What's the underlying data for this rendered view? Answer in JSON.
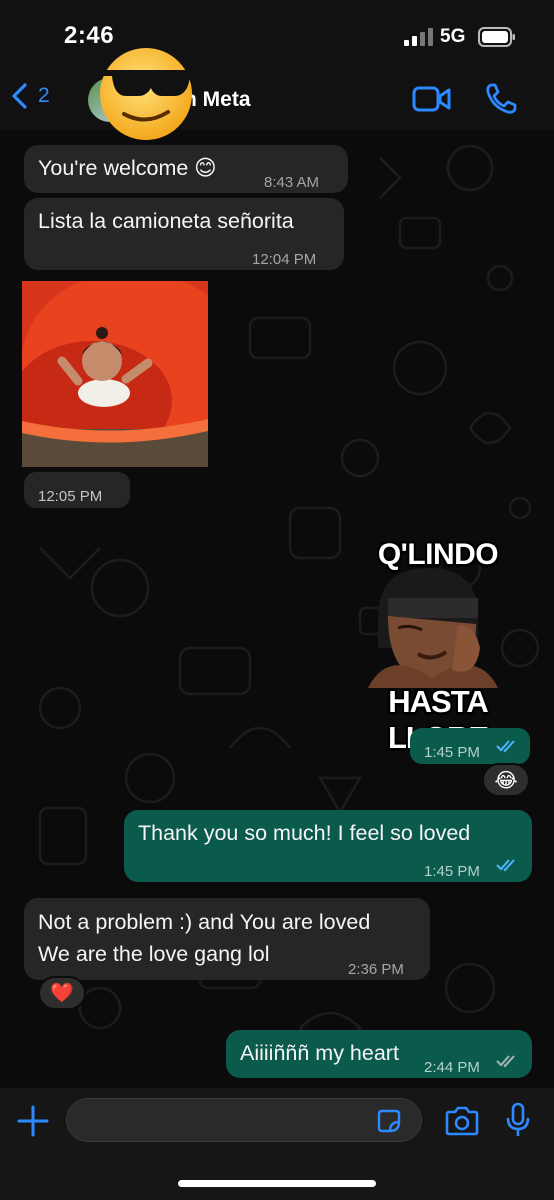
{
  "status_bar": {
    "time": "2:46",
    "network": "5G"
  },
  "header": {
    "back_count": "2",
    "contact_name": "n Meta",
    "icons": [
      "chevron-left-icon",
      "video-icon",
      "phone-icon"
    ]
  },
  "messages": [
    {
      "direction": "in",
      "text": "You're welcome 😊",
      "time": "8:43 AM"
    },
    {
      "direction": "in",
      "text": "Lista la camioneta señorita",
      "time": "12:04 PM"
    },
    {
      "direction": "in",
      "type": "photo",
      "time": "12:05 PM"
    },
    {
      "direction": "out",
      "type": "sticker",
      "sticker_top": "Q'LINDO",
      "sticker_bottom": "HASTA LLORE",
      "time": "1:45 PM",
      "reaction": "😂"
    },
    {
      "direction": "out",
      "text": "Thank you so much! I feel so loved",
      "time": "1:45 PM"
    },
    {
      "direction": "in",
      "text_line1": "Not a problem :) and  You are loved",
      "text_line2": "We are the love gang lol",
      "time": "2:36 PM",
      "reaction": "❤️"
    },
    {
      "direction": "out",
      "text": "Aiiiiñññ my heart",
      "time": "2:44 PM"
    }
  ],
  "input_bar": {
    "placeholder": ""
  },
  "colors": {
    "accent": "#2c89ff",
    "outgoing": "#0a5b4c",
    "incoming": "#262626",
    "read_tick": "#4fb3ff"
  }
}
